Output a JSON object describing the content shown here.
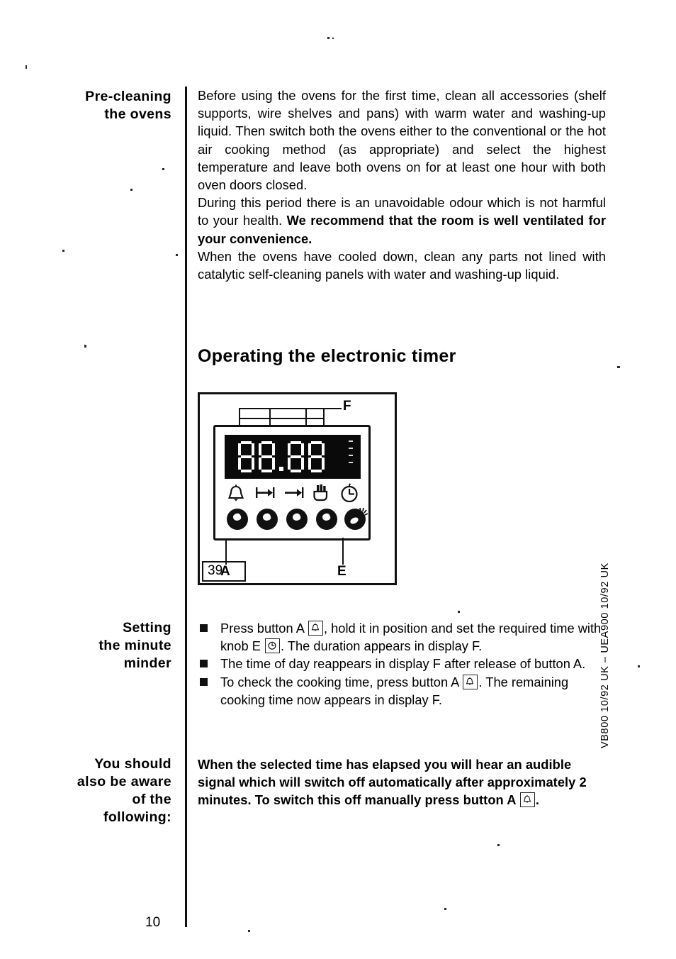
{
  "document": {
    "page_number": "10",
    "side_code": "VB800 10/92  UK – UEA900 10/92  UK"
  },
  "sections": [
    {
      "margin_heading": "Pre-cleaning\nthe ovens",
      "paragraphs": [
        "Before using the ovens for the first time, clean all accessories (shelf supports, wire shelves and pans) with warm water and washing-up liquid. Then switch both the ovens either to the conventional or the hot air cooking method (as appropriate) and select the highest temperature and leave both ovens on for at least one hour with both oven doors closed.",
        "During this period there is an unavoidable odour which is not harmful to your health. ",
        "When the ovens have cooled down, clean any parts not lined with catalytic self-cleaning panels with water and washing-up liquid."
      ],
      "bold_run": "We recommend that the room is well ventilated for your convenience."
    }
  ],
  "heading": {
    "operating_timer": "Operating the electronic timer"
  },
  "figure": {
    "number": "39",
    "label_f": "F",
    "label_a": "A",
    "label_e": "E",
    "display_value": "88.88",
    "icons": [
      {
        "name": "bell-icon",
        "title": "minute minder"
      },
      {
        "name": "cooking-duration-icon",
        "title": "cooking duration"
      },
      {
        "name": "end-time-icon",
        "title": "end of cooking time"
      },
      {
        "name": "manual-pan-icon",
        "title": "manual operation"
      },
      {
        "name": "clock-icon",
        "title": "time of day"
      }
    ],
    "buttons": [
      {
        "name": "button-a",
        "label": "A"
      },
      {
        "name": "button-2",
        "label": ""
      },
      {
        "name": "button-3",
        "label": ""
      },
      {
        "name": "button-4",
        "label": ""
      },
      {
        "name": "knob-e",
        "label": "E"
      }
    ]
  },
  "minute_minder": {
    "margin_heading": "Setting\nthe minute\nminder",
    "bullets": [
      {
        "pre": "Press button A ",
        "icon": "bell",
        "mid": ", hold it in position and set the required time with knob E ",
        "icon2": "clock",
        "post": ". The duration appears in display F."
      },
      {
        "pre": "The time of day reappears in display F after release of button A.",
        "icon": "",
        "mid": "",
        "icon2": "",
        "post": ""
      },
      {
        "pre": "To check the cooking time, press button A ",
        "icon": "bell",
        "mid": ". The remaining cooking time now appears in display F.",
        "icon2": "",
        "post": ""
      }
    ]
  },
  "aware": {
    "margin_heading": "You should\nalso be aware\nof the\nfollowing:",
    "text_pre": "When the selected time has elapsed you will hear an audible signal which will switch off automatically after approximately 2 minutes. To switch this off manually press button A ",
    "text_post": "."
  },
  "colors": {
    "ink": "#111111",
    "paper": "#ffffff",
    "lcd_background": "#0a0a0a",
    "lcd_segment": "#ffffff"
  }
}
